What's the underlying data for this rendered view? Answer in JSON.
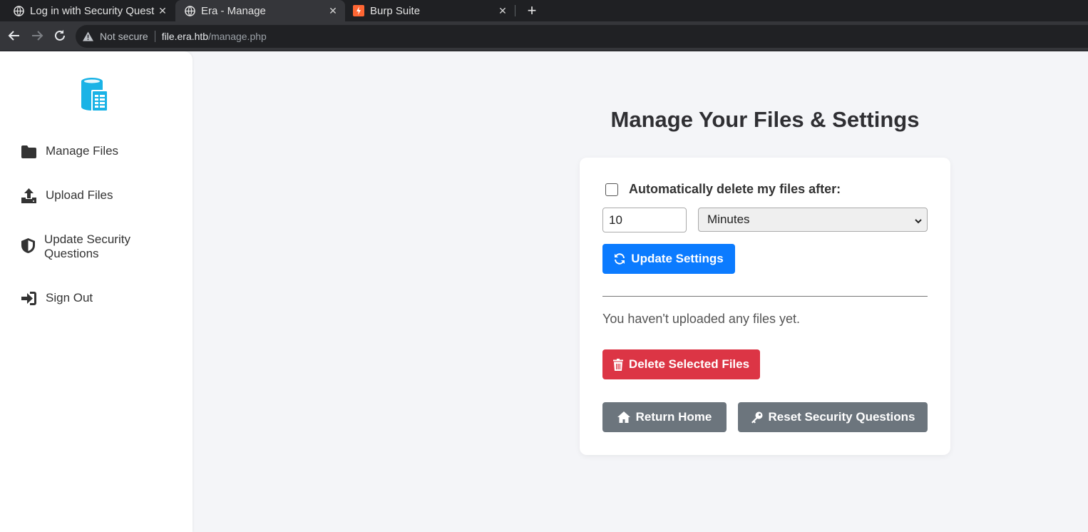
{
  "browser": {
    "tabs": [
      {
        "title": "Log in with Security Quest",
        "icon": "globe-icon"
      },
      {
        "title": "Era - Manage",
        "icon": "globe-icon",
        "active": true
      },
      {
        "title": "Burp Suite",
        "icon": "burp-icon"
      }
    ],
    "security_label": "Not secure",
    "url_host": "file.era.htb",
    "url_path": "/manage.php"
  },
  "sidebar": {
    "items": [
      {
        "label": "Manage Files",
        "icon": "folder-icon"
      },
      {
        "label": "Upload Files",
        "icon": "upload-icon"
      },
      {
        "label": "Update Security Questions",
        "icon": "shield-icon"
      },
      {
        "label": "Sign Out",
        "icon": "sign-in-icon"
      }
    ]
  },
  "main": {
    "title": "Manage Your Files & Settings",
    "auto_delete_label": "Automatically delete my files after:",
    "auto_delete_checked": false,
    "interval_value": "10",
    "interval_unit": "Minutes",
    "update_button": "Update Settings",
    "empty_message": "You haven't uploaded any files yet.",
    "delete_button": "Delete Selected Files",
    "home_button": "Return Home",
    "reset_button": "Reset Security Questions"
  },
  "colors": {
    "primary": "#0b7bff",
    "danger": "#dc3545",
    "secondary": "#6c757d",
    "logo": "#1ab3e6"
  }
}
